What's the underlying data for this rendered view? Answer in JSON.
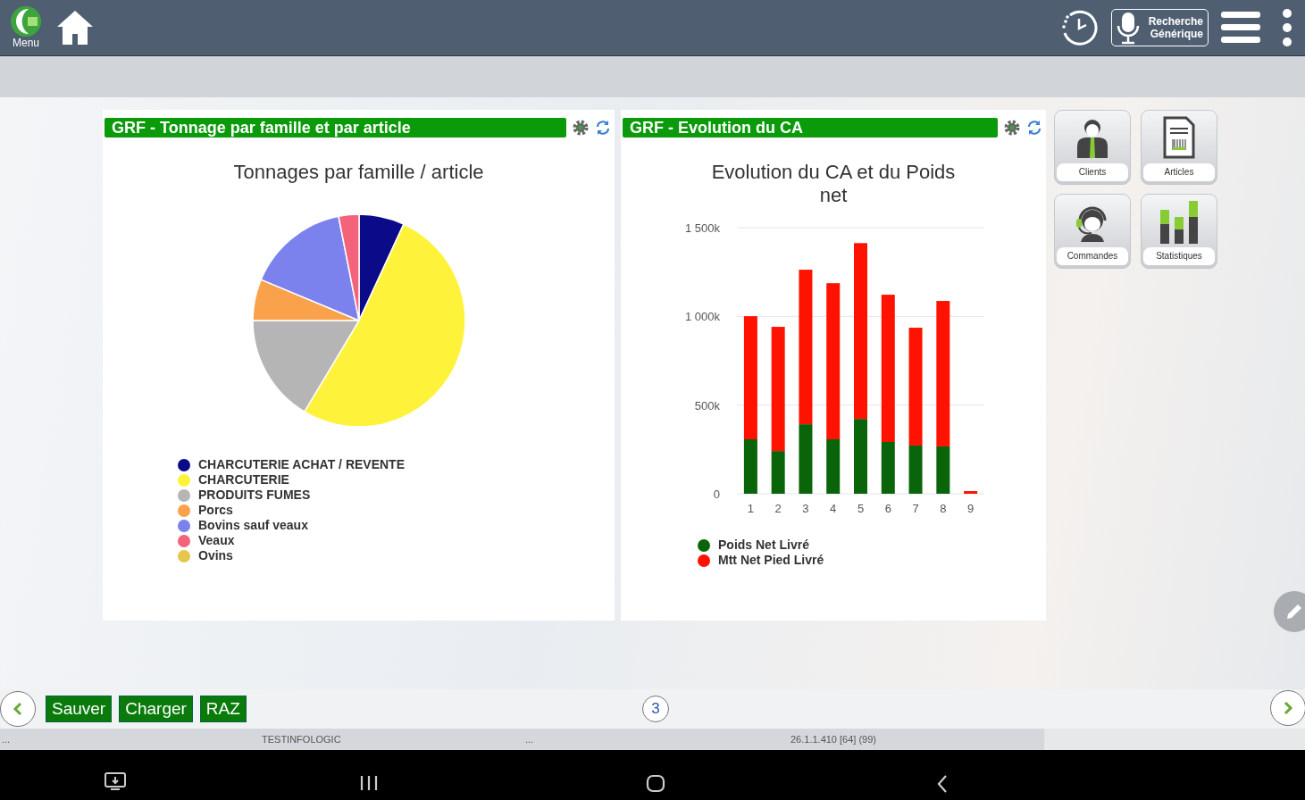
{
  "top_bar": {
    "menu_label": "Menu",
    "search_button": "Recherche Générique"
  },
  "panels": [
    {
      "header": "GRF - Tonnage par famille et par article",
      "chart_data": {
        "type": "pie",
        "title": "Tonnages par famille / article",
        "categories": [
          "CHARCUTERIE ACHAT / REVENTE",
          "CHARCUTERIE",
          "PRODUITS FUMES",
          "Porcs",
          "Bovins sauf veaux",
          "Veaux",
          "Ovins"
        ],
        "values": [
          6.9,
          51.7,
          16.4,
          6.3,
          15.6,
          3.1,
          0
        ],
        "colors": [
          "#0b0b8a",
          "#fff23a",
          "#b5b5b5",
          "#f9a24b",
          "#7b82ee",
          "#f3647b",
          "#e3c84b"
        ]
      }
    },
    {
      "header": "GRF - Evolution du CA",
      "chart_data": {
        "type": "bar",
        "title": "Evolution du CA et du Poids net",
        "categories": [
          "1",
          "2",
          "3",
          "4",
          "5",
          "6",
          "7",
          "8",
          "9"
        ],
        "stacked": true,
        "ylim": [
          0,
          1500000
        ],
        "yticks": [
          {
            "value": 0,
            "label": "0"
          },
          {
            "value": 500000,
            "label": "500k"
          },
          {
            "value": 1000000,
            "label": "1 000k"
          },
          {
            "value": 1500000,
            "label": "1 500k"
          }
        ],
        "series": [
          {
            "name": "Poids Net Livré",
            "color": "#0a650a",
            "values": [
              307000,
              241000,
              392000,
              307000,
              422000,
              292000,
              272000,
              267000,
              0
            ]
          },
          {
            "name": "Mtt Net Pied Livré",
            "color": "#ff1200",
            "values": [
              694000,
              700000,
              871000,
              880000,
              991000,
              830000,
              664000,
              820000,
              15000
            ]
          }
        ]
      }
    }
  ],
  "tiles": [
    {
      "label": "Clients",
      "kind": "clients"
    },
    {
      "label": "Articles",
      "kind": "articles"
    },
    {
      "label": "Commandes",
      "kind": "commandes"
    },
    {
      "label": "Statistiques",
      "kind": "stats"
    }
  ],
  "bottom_bar": {
    "buttons": [
      "Sauver",
      "Charger",
      "RAZ"
    ],
    "page": "3"
  },
  "status_bar": {
    "left": "...",
    "user": "TESTINFOLOGIC",
    "middle": "...",
    "version": "26.1.1.410 [64] (99)"
  }
}
